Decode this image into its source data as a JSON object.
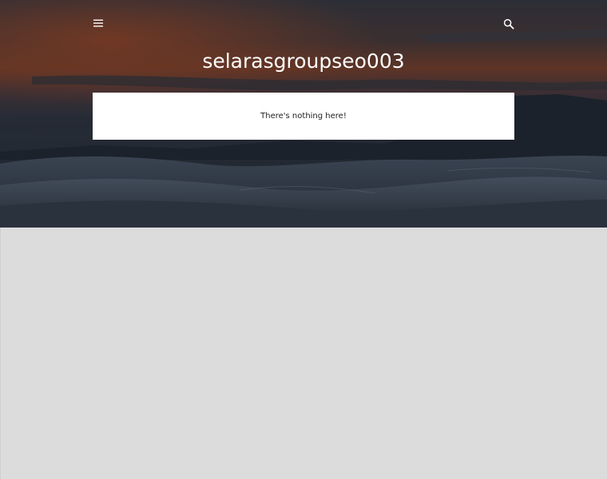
{
  "header": {
    "blog_title": "selarasgroupseo003",
    "menu_icon": "hamburger-menu-icon",
    "search_icon": "search-icon"
  },
  "message": {
    "text": "There's nothing here!"
  },
  "colors": {
    "content_background": "#dcdcdc",
    "card_background": "#ffffff",
    "title_text": "#ffffff",
    "message_text": "#212121",
    "sky_top": "#2b2f38",
    "sky_glow": "#6a3525",
    "dunes": "#2a3340"
  }
}
